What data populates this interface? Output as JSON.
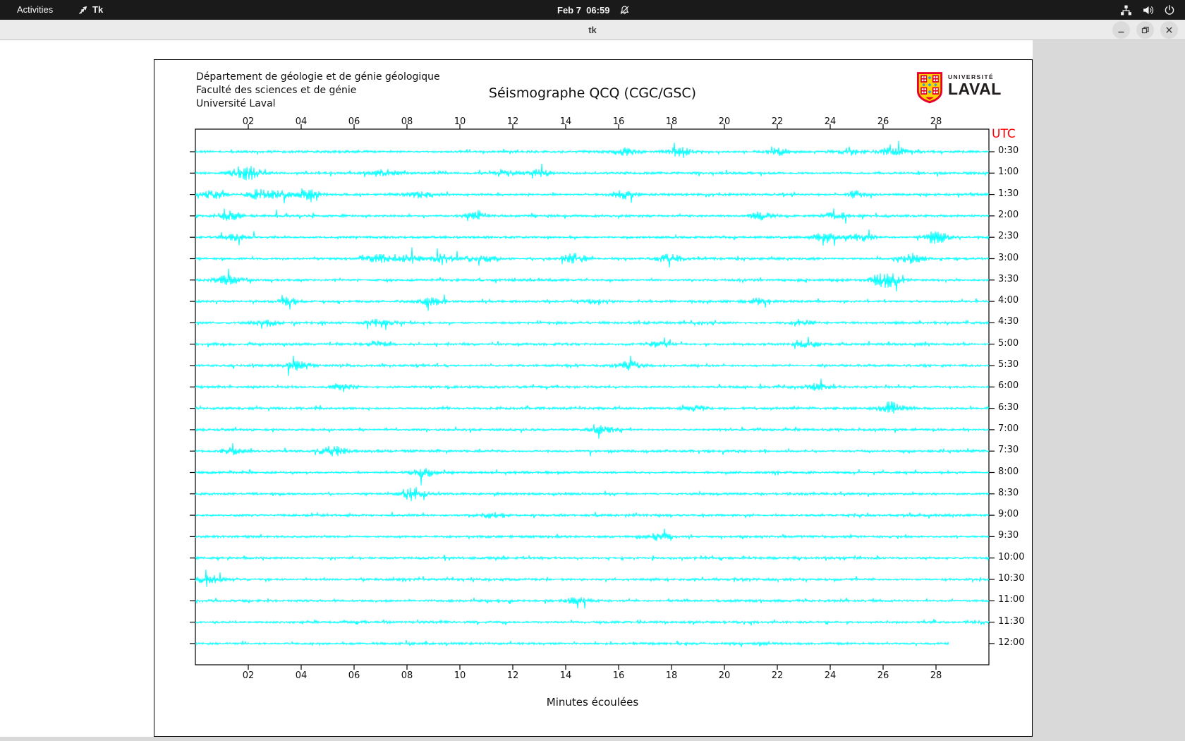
{
  "topbar": {
    "activities_label": "Activities",
    "app_label": "Tk",
    "clock": "Feb 7  06:59"
  },
  "titlebar": {
    "title": "tk"
  },
  "figure": {
    "header_lines": [
      "Département de géologie et de génie géologique",
      "Faculté des sciences et de génie",
      "Université Laval"
    ],
    "utc_label": "UTC",
    "logo": {
      "top": "UNIVERSITÉ",
      "bottom": "LAVAL"
    },
    "colors": {
      "trace": "#00ffff",
      "utc_red": "#ff0000",
      "logo_red": "#e4032e",
      "logo_yellow": "#ffd100",
      "logo_blue": "#2f9fd6"
    }
  },
  "chart_data": {
    "type": "line",
    "subtype": "seismogram-helicorder",
    "title": "Séismographe QCQ (CGC/GSC)",
    "xlabel": "Minutes écoulées",
    "ylabel_right": "UTC",
    "x_range_minutes": [
      0,
      30
    ],
    "x_tick_labels": [
      "02",
      "04",
      "06",
      "08",
      "10",
      "12",
      "14",
      "16",
      "18",
      "20",
      "22",
      "24",
      "26",
      "28"
    ],
    "grid": false,
    "trace_color": "#00ffff",
    "rows": [
      {
        "utc": "0:30",
        "end_minute": 30,
        "events": [
          [
            16.2,
            5
          ],
          [
            18.3,
            6
          ],
          [
            22.0,
            5
          ],
          [
            24.8,
            6
          ],
          [
            26.4,
            7
          ]
        ]
      },
      {
        "utc": "1:00",
        "end_minute": 30,
        "events": [
          [
            1.7,
            7
          ],
          [
            2.1,
            6
          ],
          [
            7.2,
            5
          ],
          [
            11.8,
            4
          ],
          [
            13.0,
            5
          ]
        ]
      },
      {
        "utc": "1:30",
        "end_minute": 30,
        "events": [
          [
            0.7,
            6
          ],
          [
            2.4,
            7
          ],
          [
            3.2,
            5
          ],
          [
            4.3,
            6
          ],
          [
            8.6,
            6
          ],
          [
            16.2,
            6
          ],
          [
            25.0,
            5
          ]
        ]
      },
      {
        "utc": "2:00",
        "end_minute": 30,
        "events": [
          [
            1.3,
            6
          ],
          [
            10.6,
            5
          ],
          [
            21.4,
            6
          ],
          [
            24.2,
            5
          ]
        ]
      },
      {
        "utc": "2:30",
        "end_minute": 30,
        "events": [
          [
            1.5,
            4
          ],
          [
            23.8,
            6
          ],
          [
            25.2,
            6
          ],
          [
            28.0,
            9
          ]
        ]
      },
      {
        "utc": "3:00",
        "end_minute": 30,
        "events": [
          [
            6.9,
            6
          ],
          [
            8.1,
            5
          ],
          [
            9.4,
            6
          ],
          [
            11.0,
            4
          ],
          [
            14.3,
            8
          ],
          [
            17.9,
            6
          ],
          [
            27.1,
            7
          ]
        ]
      },
      {
        "utc": "3:30",
        "end_minute": 30,
        "events": [
          [
            1.2,
            6
          ],
          [
            25.9,
            7
          ],
          [
            26.4,
            6
          ]
        ]
      },
      {
        "utc": "4:00",
        "end_minute": 30,
        "events": [
          [
            3.5,
            6
          ],
          [
            8.9,
            5
          ],
          [
            15.2,
            4
          ],
          [
            21.3,
            4
          ]
        ]
      },
      {
        "utc": "4:30",
        "end_minute": 30,
        "events": [
          [
            2.6,
            5
          ],
          [
            7.0,
            6
          ],
          [
            22.9,
            4
          ]
        ]
      },
      {
        "utc": "5:00",
        "end_minute": 30,
        "events": [
          [
            6.9,
            4
          ],
          [
            17.5,
            4
          ],
          [
            23.2,
            4
          ]
        ]
      },
      {
        "utc": "5:30",
        "end_minute": 30,
        "events": [
          [
            3.9,
            6
          ],
          [
            16.4,
            6
          ]
        ]
      },
      {
        "utc": "6:00",
        "end_minute": 30,
        "events": [
          [
            5.6,
            5
          ],
          [
            23.5,
            4
          ]
        ]
      },
      {
        "utc": "6:30",
        "end_minute": 30,
        "events": [
          [
            18.9,
            4
          ],
          [
            26.3,
            9
          ]
        ]
      },
      {
        "utc": "7:00",
        "end_minute": 30,
        "events": [
          [
            15.4,
            5
          ]
        ]
      },
      {
        "utc": "7:30",
        "end_minute": 30,
        "events": [
          [
            1.4,
            5
          ],
          [
            5.2,
            7
          ]
        ]
      },
      {
        "utc": "8:00",
        "end_minute": 30,
        "events": [
          [
            8.6,
            7
          ]
        ]
      },
      {
        "utc": "8:30",
        "end_minute": 30,
        "events": [
          [
            8.2,
            10
          ]
        ]
      },
      {
        "utc": "9:00",
        "end_minute": 30,
        "events": [
          [
            11.3,
            5
          ]
        ]
      },
      {
        "utc": "9:30",
        "end_minute": 30,
        "events": [
          [
            17.6,
            6
          ]
        ]
      },
      {
        "utc": "10:00",
        "end_minute": 30,
        "events": []
      },
      {
        "utc": "10:30",
        "end_minute": 30,
        "events": [
          [
            0.5,
            6
          ]
        ]
      },
      {
        "utc": "11:00",
        "end_minute": 30,
        "events": [
          [
            14.5,
            5
          ]
        ]
      },
      {
        "utc": "11:30",
        "end_minute": 30,
        "events": []
      },
      {
        "utc": "12:00",
        "end_minute": 28.5,
        "events": []
      }
    ]
  }
}
